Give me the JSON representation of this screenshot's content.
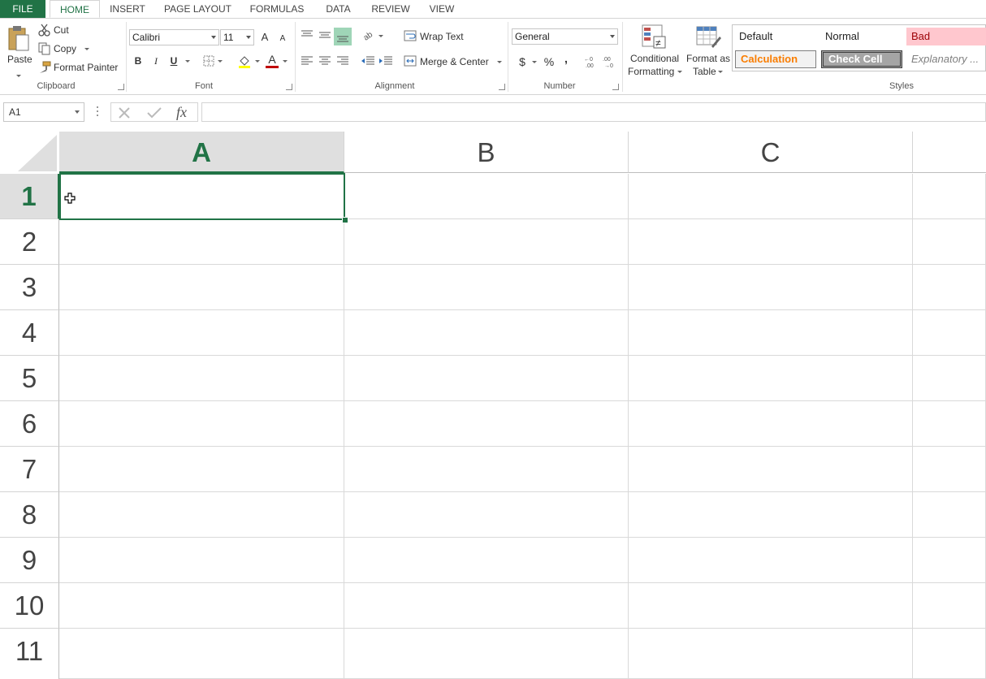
{
  "tabs": [
    "FILE",
    "HOME",
    "INSERT",
    "PAGE LAYOUT",
    "FORMULAS",
    "DATA",
    "REVIEW",
    "VIEW"
  ],
  "clipboard": {
    "paste": "Paste",
    "cut": "Cut",
    "copy": "Copy",
    "format_painter": "Format Painter",
    "label": "Clipboard"
  },
  "font": {
    "name": "Calibri",
    "size": "11",
    "bold": "B",
    "italic": "I",
    "underline": "U",
    "grow": "A",
    "shrink": "A",
    "font_color_glyph": "A",
    "label": "Font"
  },
  "alignment": {
    "wrap_text": "Wrap Text",
    "merge_center": "Merge & Center",
    "label": "Alignment"
  },
  "number": {
    "format": "General",
    "currency": "$",
    "percent": "%",
    "comma": ",",
    "label": "Number"
  },
  "styles_group": {
    "conditional_line1": "Conditional",
    "conditional_line2": "Formatting",
    "format_table_line1": "Format as",
    "format_table_line2": "Table",
    "label": "Styles"
  },
  "styles": {
    "default": "Default",
    "normal": "Normal",
    "bad": "Bad",
    "calculation": "Calculation",
    "check_cell": "Check Cell",
    "explanatory": "Explanatory ..."
  },
  "formula_bar": {
    "name_box": "A1",
    "fx": "fx",
    "value": ""
  },
  "columns": [
    "A",
    "B",
    "C"
  ],
  "rows": [
    "1",
    "2",
    "3",
    "4",
    "5",
    "6",
    "7",
    "8",
    "9",
    "10",
    "11"
  ],
  "colors": {
    "accent": "#217346",
    "bad_bg": "#ffc7ce",
    "bad_fg": "#9c0006",
    "calc_fg": "#fa7d00",
    "check_bg": "#a5a5a5"
  }
}
